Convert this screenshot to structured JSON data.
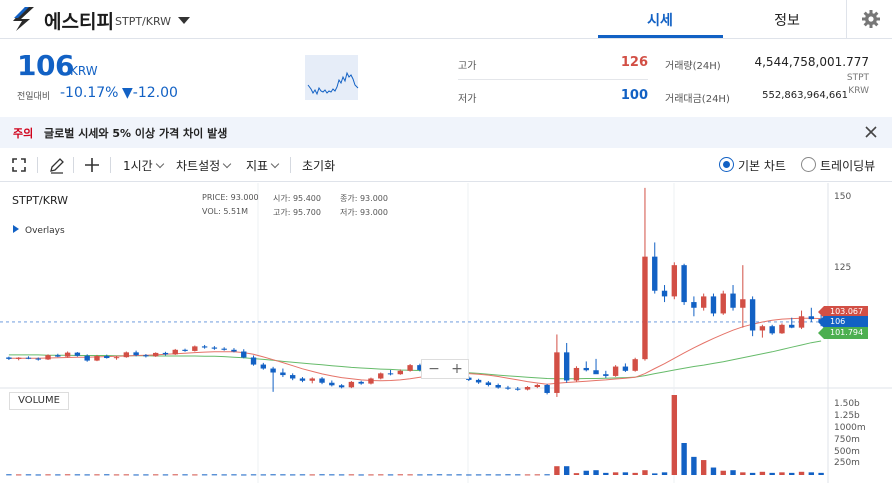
{
  "header": {
    "coin_name": "에스티피",
    "coin_pair": "STPT/KRW",
    "tabs": [
      {
        "label": "시세",
        "active": true
      },
      {
        "label": "정보",
        "active": false
      }
    ]
  },
  "summary": {
    "price": "106",
    "price_unit": "KRW",
    "change_label": "전일대비",
    "change_rate": "-10.17%",
    "change_amount": "▼-12.00",
    "high_label": "고가",
    "high_value": "126",
    "low_label": "저가",
    "low_value": "100",
    "volume_label": "거래량(24H)",
    "volume_value": "4,544,758,001.777",
    "volume_unit": "STPT",
    "amount_label": "거래대금(24H)",
    "amount_value": "552,863,964,661",
    "amount_unit": "KRW",
    "up_color": "#d24f45",
    "down_color": "#1261c4"
  },
  "notice": {
    "tag": "주의",
    "text": "글로벌 시세와 5% 이상 가격 차이 발생"
  },
  "toolbar": {
    "interval": "1시간",
    "chart_settings": "차트설정",
    "indicators": "지표",
    "reset": "초기화",
    "view_basic": "기본 차트",
    "view_tradingview": "트레이딩뷰"
  },
  "chart": {
    "symbol": "STPT/KRW",
    "overlays_label": "Overlays",
    "ohlc": {
      "price_label": "PRICE:",
      "price": "93.000",
      "open_label": "시가:",
      "open": "95.400",
      "close_label": "종가:",
      "close": "93.000",
      "vol_label": "VOL:",
      "vol": "5.51M",
      "high_label": "고가:",
      "high": "95.700",
      "low_label": "저가:",
      "low": "93.000"
    },
    "volume_label": "VOLUME",
    "zoom_out": "−",
    "zoom_in": "+",
    "price_ticks": [
      "150",
      "125"
    ],
    "volume_ticks": [
      "1.50b",
      "1.25b",
      "1000m",
      "750m",
      "500m",
      "250m"
    ],
    "tag_ma1": "103.067",
    "tag_last": "106",
    "tag_ma2": "101.794",
    "tag_ma1_color": "#d24f45",
    "tag_last_color": "#1261c4",
    "tag_ma2_color": "#4caf50"
  },
  "chart_data": {
    "type": "candlestick",
    "price_axis_ticks": [
      125,
      150
    ],
    "volume_axis_ticks_label": [
      "250m",
      "500m",
      "750m",
      "1000m",
      "1.25b",
      "1.50b"
    ],
    "last_price": 106,
    "moving_averages": [
      103.067,
      101.794
    ],
    "candles": [
      [
        93.5,
        93.8,
        92.6,
        93.0
      ],
      [
        93.0,
        93.6,
        92.5,
        93.4
      ],
      [
        93.4,
        93.9,
        92.9,
        93.1
      ],
      [
        93.1,
        93.5,
        92.4,
        92.8
      ],
      [
        92.8,
        94.6,
        92.6,
        94.3
      ],
      [
        94.3,
        94.8,
        93.6,
        93.8
      ],
      [
        93.8,
        95.6,
        93.5,
        95.2
      ],
      [
        95.2,
        95.4,
        93.8,
        94.1
      ],
      [
        94.1,
        94.6,
        92.0,
        92.4
      ],
      [
        92.4,
        94.4,
        92.2,
        94.0
      ],
      [
        94.0,
        94.5,
        93.1,
        93.3
      ],
      [
        93.3,
        94.0,
        92.7,
        93.6
      ],
      [
        93.6,
        95.6,
        93.4,
        95.3
      ],
      [
        95.3,
        95.9,
        93.9,
        94.3
      ],
      [
        94.3,
        94.7,
        93.5,
        93.9
      ],
      [
        93.9,
        95.3,
        93.7,
        95.1
      ],
      [
        95.1,
        95.5,
        94.2,
        94.6
      ],
      [
        94.6,
        96.5,
        94.4,
        96.2
      ],
      [
        96.2,
        96.6,
        95.5,
        95.8
      ],
      [
        95.8,
        97.7,
        95.6,
        97.4
      ],
      [
        97.4,
        97.9,
        96.6,
        97.0
      ],
      [
        97.0,
        97.5,
        96.2,
        96.6
      ],
      [
        96.6,
        97.1,
        95.9,
        96.2
      ],
      [
        96.2,
        96.8,
        95.3,
        95.6
      ],
      [
        95.6,
        96.4,
        93.2,
        93.5
      ],
      [
        93.5,
        94.2,
        90.6,
        91.0
      ],
      [
        91.0,
        91.6,
        89.2,
        89.6
      ],
      [
        89.6,
        90.2,
        81.4,
        88.2
      ],
      [
        88.2,
        89.6,
        86.6,
        87.3
      ],
      [
        87.3,
        87.9,
        85.5,
        86.1
      ],
      [
        86.1,
        86.6,
        84.8,
        85.3
      ],
      [
        85.3,
        86.5,
        84.4,
        86.1
      ],
      [
        86.1,
        86.6,
        84.1,
        84.6
      ],
      [
        84.6,
        85.4,
        83.3,
        83.7
      ],
      [
        83.7,
        84.1,
        82.6,
        83.0
      ],
      [
        83.0,
        85.2,
        82.7,
        84.9
      ],
      [
        84.9,
        85.3,
        83.9,
        84.3
      ],
      [
        84.3,
        86.4,
        84.0,
        86.1
      ],
      [
        86.1,
        88.2,
        85.8,
        87.9
      ],
      [
        87.9,
        89.1,
        87.2,
        87.6
      ],
      [
        87.6,
        89.3,
        87.4,
        88.8
      ],
      [
        88.8,
        91.2,
        88.5,
        90.8
      ],
      [
        90.8,
        91.3,
        88.6,
        89.1
      ],
      [
        89.1,
        89.6,
        88.1,
        88.6
      ],
      [
        88.6,
        89.0,
        87.4,
        87.9
      ],
      [
        87.9,
        88.4,
        86.6,
        87.1
      ],
      [
        87.1,
        87.6,
        86.0,
        86.4
      ],
      [
        86.4,
        86.9,
        85.2,
        85.6
      ],
      [
        85.6,
        86.0,
        84.2,
        84.7
      ],
      [
        84.7,
        85.2,
        83.3,
        83.8
      ],
      [
        83.8,
        84.3,
        82.5,
        82.9
      ],
      [
        82.9,
        83.5,
        82.1,
        82.5
      ],
      [
        82.5,
        83.1,
        81.8,
        82.2
      ],
      [
        82.2,
        83.4,
        81.9,
        83.1
      ],
      [
        83.1,
        84.2,
        82.7,
        83.8
      ],
      [
        83.8,
        84.2,
        80.5,
        81.0
      ],
      [
        81.0,
        101.6,
        79.6,
        95.3
      ],
      [
        95.3,
        98.6,
        84.6,
        85.4
      ],
      [
        85.4,
        90.4,
        85.0,
        89.8
      ],
      [
        89.8,
        92.1,
        88.6,
        89.0
      ],
      [
        89.0,
        93.0,
        88.3,
        87.6
      ],
      [
        87.6,
        88.8,
        86.3,
        87.0
      ],
      [
        87.0,
        90.8,
        86.7,
        90.3
      ],
      [
        90.3,
        91.4,
        88.4,
        88.8
      ],
      [
        88.8,
        93.4,
        88.5,
        92.9
      ],
      [
        92.9,
        153.2,
        92.4,
        129.0
      ],
      [
        129.0,
        134.0,
        116.0,
        117.0
      ],
      [
        117.0,
        119.0,
        113.0,
        115.0
      ],
      [
        115.0,
        127.0,
        114.0,
        126.0
      ],
      [
        126.0,
        126.5,
        112.0,
        113.0
      ],
      [
        113.0,
        115.0,
        108.0,
        111.0
      ],
      [
        111.0,
        116.0,
        110.0,
        115.0
      ],
      [
        115.0,
        116.0,
        108.0,
        109.0
      ],
      [
        109.0,
        117.0,
        108.5,
        116.0
      ],
      [
        116.0,
        119.0,
        110.0,
        111.0
      ],
      [
        111.0,
        126.0,
        104.0,
        114.0
      ],
      [
        114.0,
        115.0,
        101.0,
        103.0
      ],
      [
        103.0,
        105.0,
        100.5,
        104.5
      ],
      [
        104.5,
        105.0,
        101.5,
        102.0
      ],
      [
        102.0,
        105.5,
        101.8,
        105.0
      ],
      [
        105.0,
        107.5,
        103.8,
        104.0
      ],
      [
        104.0,
        110.0,
        103.5,
        108.0
      ],
      [
        108.0,
        111.0,
        106.0,
        107.0
      ],
      [
        107.0,
        108.5,
        104.5,
        106.0
      ]
    ],
    "volume": [
      0.013,
      0.011,
      0.012,
      0.01,
      0.012,
      0.011,
      0.013,
      0.012,
      0.011,
      0.012,
      0.013,
      0.011,
      0.012,
      0.01,
      0.011,
      0.012,
      0.011,
      0.013,
      0.012,
      0.011,
      0.012,
      0.013,
      0.011,
      0.012,
      0.01,
      0.012,
      0.011,
      0.013,
      0.012,
      0.011,
      0.012,
      0.011,
      0.013,
      0.012,
      0.011,
      0.012,
      0.01,
      0.011,
      0.012,
      0.011,
      0.013,
      0.012,
      0.011,
      0.012,
      0.013,
      0.011,
      0.012,
      0.01,
      0.011,
      0.012,
      0.011,
      0.013,
      0.012,
      0.011,
      0.012,
      0.013,
      0.165,
      0.165,
      0.035,
      0.08,
      0.09,
      0.04,
      0.05,
      0.05,
      0.04,
      0.09,
      0.03,
      0.05,
      1.5,
      0.6,
      0.34,
      0.28,
      0.14,
      0.08,
      0.09,
      0.05,
      0.04,
      0.06,
      0.04,
      0.05,
      0.04,
      0.06,
      0.05,
      0.04
    ],
    "ma_short": [
      93.2,
      93.2,
      93.2,
      93.2,
      93.3,
      93.4,
      93.5,
      93.6,
      93.6,
      93.7,
      93.8,
      93.9,
      94.0,
      94.2,
      94.3,
      94.4,
      94.6,
      94.8,
      95.0,
      95.2,
      95.4,
      95.5,
      95.5,
      95.5,
      95.2,
      94.6,
      93.7,
      92.7,
      91.7,
      90.6,
      89.5,
      88.6,
      87.7,
      87.0,
      86.4,
      86.0,
      85.6,
      85.4,
      85.3,
      85.4,
      85.6,
      86.0,
      86.5,
      87.0,
      87.4,
      87.7,
      87.8,
      87.8,
      87.6,
      87.3,
      86.8,
      86.2,
      85.6,
      85.0,
      84.5,
      84.1,
      84.4,
      84.7,
      84.9,
      85.1,
      85.4,
      85.6,
      85.9,
      86.2,
      86.5,
      87.8,
      89.6,
      91.3,
      93.2,
      95.1,
      96.9,
      98.6,
      100.2,
      101.7,
      103.1,
      104.3,
      105.2,
      106.0,
      106.6,
      107.0,
      107.2,
      107.3,
      107.3,
      107.2
    ],
    "ma_long": [
      94.4,
      94.4,
      94.4,
      94.4,
      94.3,
      94.3,
      94.3,
      94.2,
      94.2,
      94.2,
      94.2,
      94.1,
      94.1,
      94.1,
      94.1,
      94.0,
      94.0,
      94.0,
      94.0,
      94.0,
      93.9,
      93.9,
      93.8,
      93.6,
      93.4,
      93.1,
      92.8,
      92.5,
      92.1,
      91.8,
      91.5,
      91.2,
      90.9,
      90.6,
      90.3,
      90.0,
      89.8,
      89.6,
      89.4,
      89.3,
      89.1,
      89.0,
      88.9,
      88.8,
      88.6,
      88.5,
      88.3,
      88.1,
      87.9,
      87.6,
      87.3,
      87.0,
      86.8,
      86.5,
      86.3,
      86.1,
      86.0,
      86.0,
      86.0,
      86.1,
      86.1,
      86.2,
      86.3,
      86.4,
      86.6,
      87.1,
      87.8,
      88.4,
      89.1,
      89.7,
      90.3,
      90.8,
      91.4,
      92.0,
      92.7,
      93.4,
      94.1,
      94.8,
      95.5,
      96.3,
      97.1,
      97.9,
      98.7,
      99.3
    ]
  }
}
